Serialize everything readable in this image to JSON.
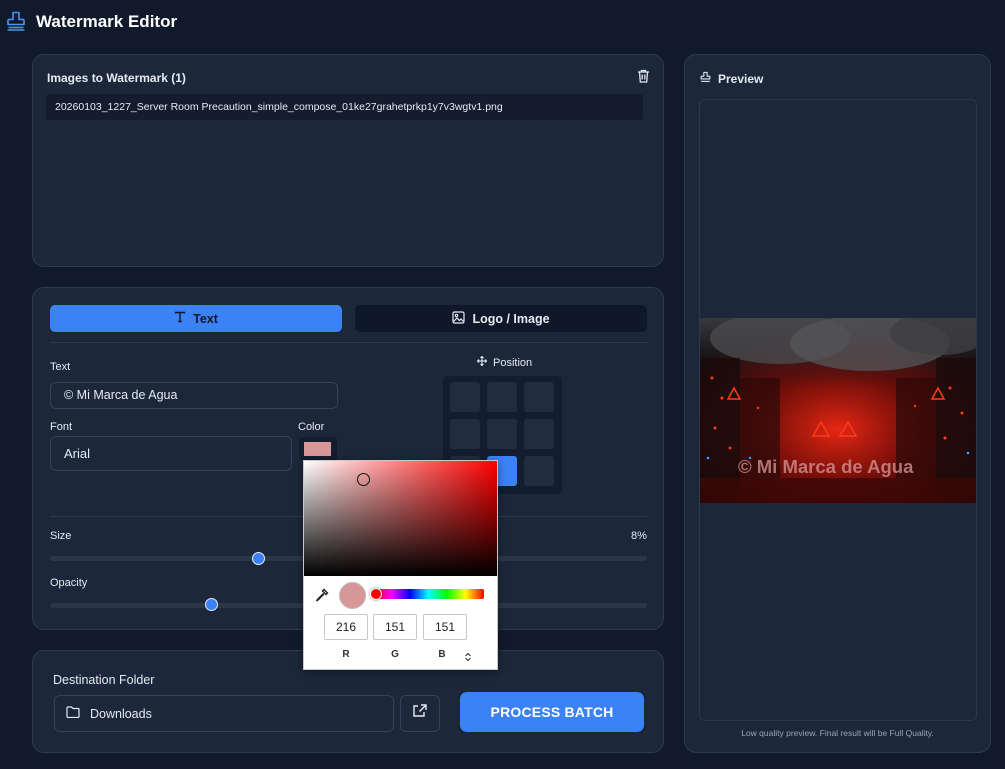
{
  "app": {
    "title": "Watermark Editor"
  },
  "images_panel": {
    "title": "Images to Watermark (1)",
    "files": [
      "20260103_1227_Server Room Precaution_simple_compose_01ke27grahetprkp1y7v3wgtv1.png"
    ]
  },
  "tabs": [
    {
      "label": "Text",
      "icon": "text-icon",
      "active": true
    },
    {
      "label": "Logo / Image",
      "icon": "image-icon",
      "active": false
    }
  ],
  "text_settings": {
    "text_label": "Text",
    "text_value": "© Mi Marca de Agua",
    "font_label": "Font",
    "font_value": "Arial",
    "color_label": "Color",
    "color_value": "#d89797",
    "position_label": "Position",
    "size_label": "Size",
    "size_value": "8%",
    "size_fraction": 0.35,
    "opacity_label": "Opacity",
    "opacity_fraction": 0.27
  },
  "color_picker": {
    "r": "216",
    "g": "151",
    "b": "151",
    "r_label": "R",
    "g_label": "G",
    "b_label": "B"
  },
  "destination": {
    "label": "Destination Folder",
    "folder": "Downloads",
    "process_label": "PROCESS BATCH"
  },
  "preview": {
    "title": "Preview",
    "watermark_text": "© Mi Marca de Agua",
    "footnote": "Low quality preview. Final result will be Full Quality."
  },
  "colors": {
    "accent": "#3b82f6",
    "background": "#111a2b",
    "panel": "#1c273a"
  }
}
